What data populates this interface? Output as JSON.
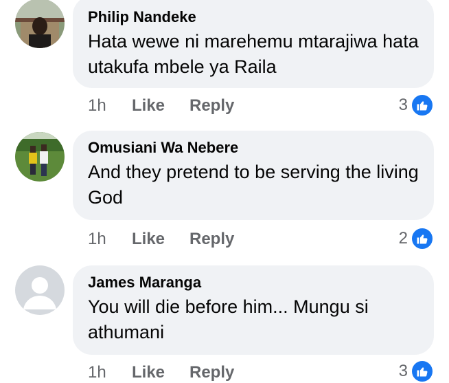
{
  "comments": [
    {
      "author": "Philip Nandeke",
      "text": "Hata wewe ni marehemu mtarajiwa hata utakufa mbele ya Raila",
      "time": "1h",
      "like_label": "Like",
      "reply_label": "Reply",
      "reaction_count": "3",
      "reaction_icon": "like-icon",
      "avatar": "profile-photo"
    },
    {
      "author": "Omusiani Wa Nebere",
      "text": "And they pretend to be serving the living God",
      "time": "1h",
      "like_label": "Like",
      "reply_label": "Reply",
      "reaction_count": "2",
      "reaction_icon": "like-icon",
      "avatar": "profile-photo"
    },
    {
      "author": "James Maranga",
      "text": "You will die before him... Mungu si athumani",
      "time": "1h",
      "like_label": "Like",
      "reply_label": "Reply",
      "reaction_count": "3",
      "reaction_icon": "like-icon",
      "avatar": "default-avatar"
    }
  ],
  "colors": {
    "bubble_bg": "#f0f2f5",
    "meta_text": "#65676b",
    "like_blue": "#1877f2"
  }
}
